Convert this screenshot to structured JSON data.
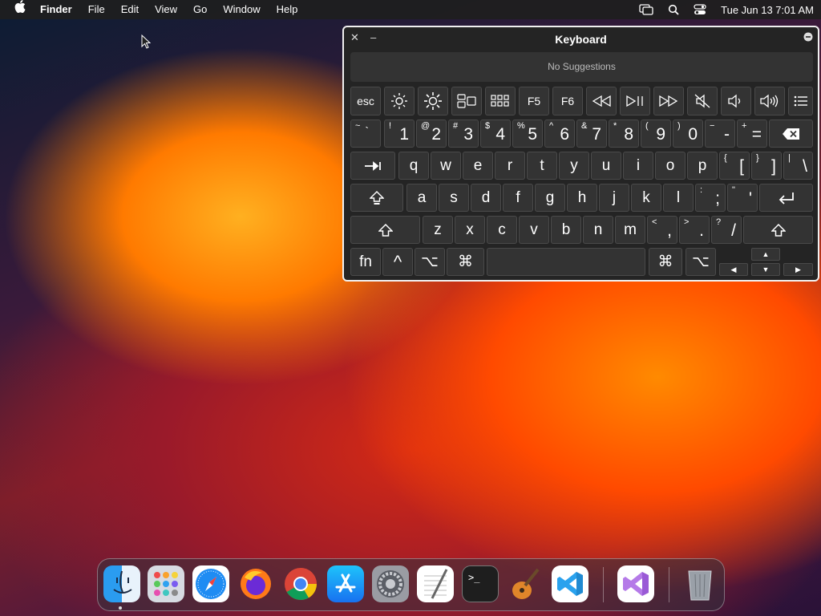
{
  "menubar": {
    "app_name": "Finder",
    "menus": [
      "File",
      "Edit",
      "View",
      "Go",
      "Window",
      "Help"
    ],
    "clock": "Tue Jun 13  7:01 AM"
  },
  "keyboard_viewer": {
    "title": "Keyboard",
    "suggestions": "No Suggestions",
    "fn_row": [
      "esc",
      "F5",
      "F6"
    ],
    "number_row": [
      {
        "shift": "~",
        "base": "`"
      },
      {
        "shift": "!",
        "base": "1"
      },
      {
        "shift": "@",
        "base": "2"
      },
      {
        "shift": "#",
        "base": "3"
      },
      {
        "shift": "$",
        "base": "4"
      },
      {
        "shift": "%",
        "base": "5"
      },
      {
        "shift": "^",
        "base": "6"
      },
      {
        "shift": "&",
        "base": "7"
      },
      {
        "shift": "*",
        "base": "8"
      },
      {
        "shift": "(",
        "base": "9"
      },
      {
        "shift": ")",
        "base": "0"
      },
      {
        "shift": "−",
        "base": "-"
      },
      {
        "shift": "+",
        "base": "="
      }
    ],
    "row_q": [
      "q",
      "w",
      "e",
      "r",
      "t",
      "y",
      "u",
      "i",
      "o",
      "p"
    ],
    "row_q_symbols": [
      {
        "shift": "{",
        "base": "["
      },
      {
        "shift": "}",
        "base": "]"
      },
      {
        "shift": "|",
        "base": "\\"
      }
    ],
    "row_a": [
      "a",
      "s",
      "d",
      "f",
      "g",
      "h",
      "j",
      "k",
      "l"
    ],
    "row_a_symbols": [
      {
        "shift": ":",
        "base": ";"
      },
      {
        "shift": "\"",
        "base": "'"
      }
    ],
    "row_z": [
      "z",
      "x",
      "c",
      "v",
      "b",
      "n",
      "m"
    ],
    "row_z_symbols": [
      {
        "shift": "<",
        "base": ","
      },
      {
        "shift": ">",
        "base": "."
      },
      {
        "shift": "?",
        "base": "/"
      }
    ],
    "bottom": {
      "fn": "fn",
      "ctrl": "^",
      "option": "⌥",
      "command": "⌘"
    }
  },
  "dock": {
    "apps": [
      "Finder",
      "Launchpad",
      "Safari",
      "Firefox",
      "Chrome",
      "App Store",
      "System Settings",
      "TextEdit",
      "Terminal",
      "GarageBand",
      "VS Code",
      "Visual Studio",
      "Trash"
    ]
  }
}
